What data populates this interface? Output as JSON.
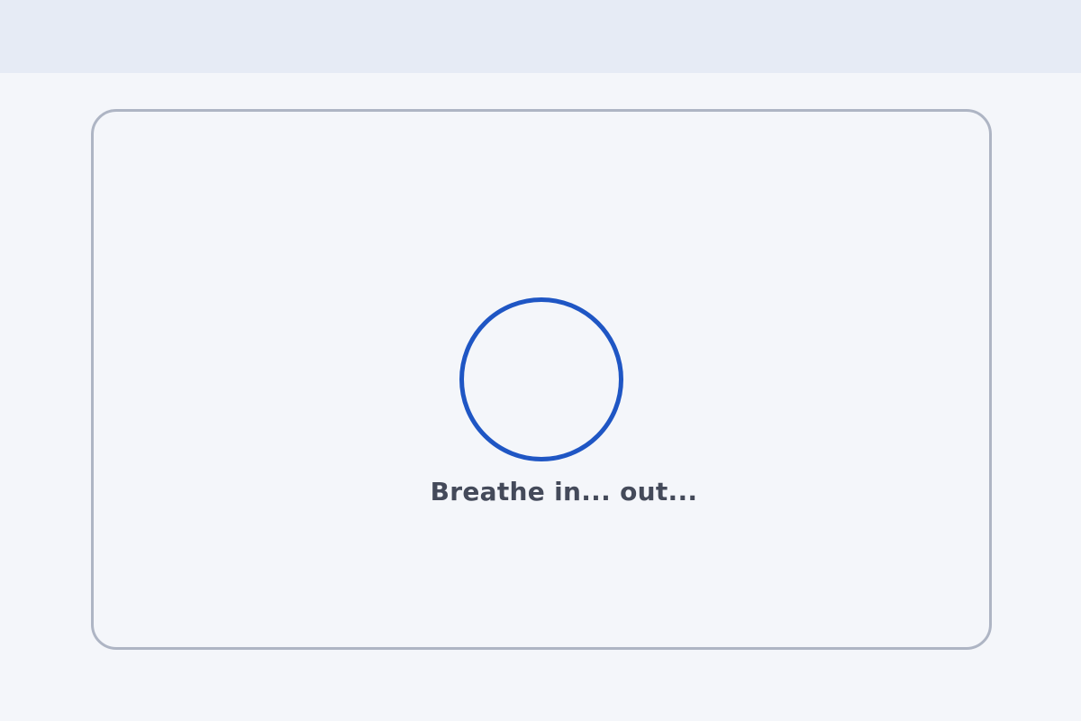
{
  "breathing": {
    "label": "Breathe in... out..."
  },
  "colors": {
    "top_bar": "#e6ebf5",
    "background": "#f4f6fa",
    "panel_border": "#aeb5c4",
    "circle": "#1f56c4",
    "label_text": "#444a5a"
  }
}
